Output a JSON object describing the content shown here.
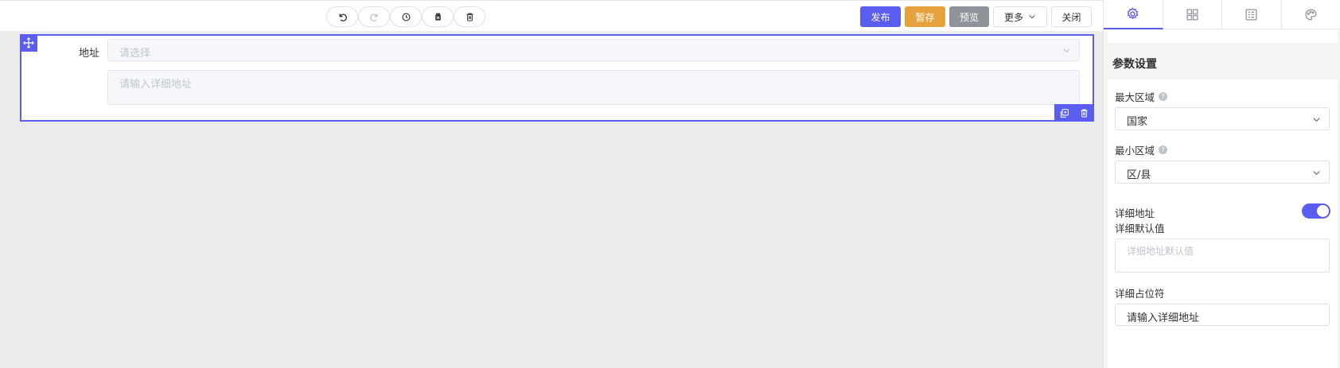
{
  "toolbar": {
    "history_buttons": [
      {
        "icon": "undo-icon",
        "enabled": true
      },
      {
        "icon": "redo-icon",
        "enabled": false
      },
      {
        "icon": "history-clock-icon",
        "enabled": true
      },
      {
        "icon": "clear-icon",
        "enabled": true
      },
      {
        "icon": "delete-icon",
        "enabled": true
      }
    ],
    "publish_label": "发布",
    "save_label": "暂存",
    "preview_label": "预览",
    "more_label": "更多",
    "close_label": "关闭"
  },
  "canvas": {
    "field": {
      "label": "地址",
      "select_placeholder": "请选择",
      "detail_placeholder": "请输入详细地址"
    }
  },
  "panel": {
    "tabs": [
      "settings-icon",
      "components-icon",
      "form-icon",
      "theme-icon"
    ],
    "active_tab": 0,
    "section_title": "参数设置",
    "max_area_label": "最大区域",
    "max_area_value": "国家",
    "min_area_label": "最小区域",
    "min_area_value": "区/县",
    "detail_address_label": "详细地址",
    "detail_address_enabled": true,
    "detail_default_label": "详细默认值",
    "detail_default_placeholder": "详细地址默认值",
    "detail_placeholder_label": "详细占位符",
    "detail_placeholder_value": "请输入详细地址"
  },
  "colors": {
    "primary": "#5b5cf0",
    "warning": "#e6a23c",
    "info": "#909399"
  }
}
